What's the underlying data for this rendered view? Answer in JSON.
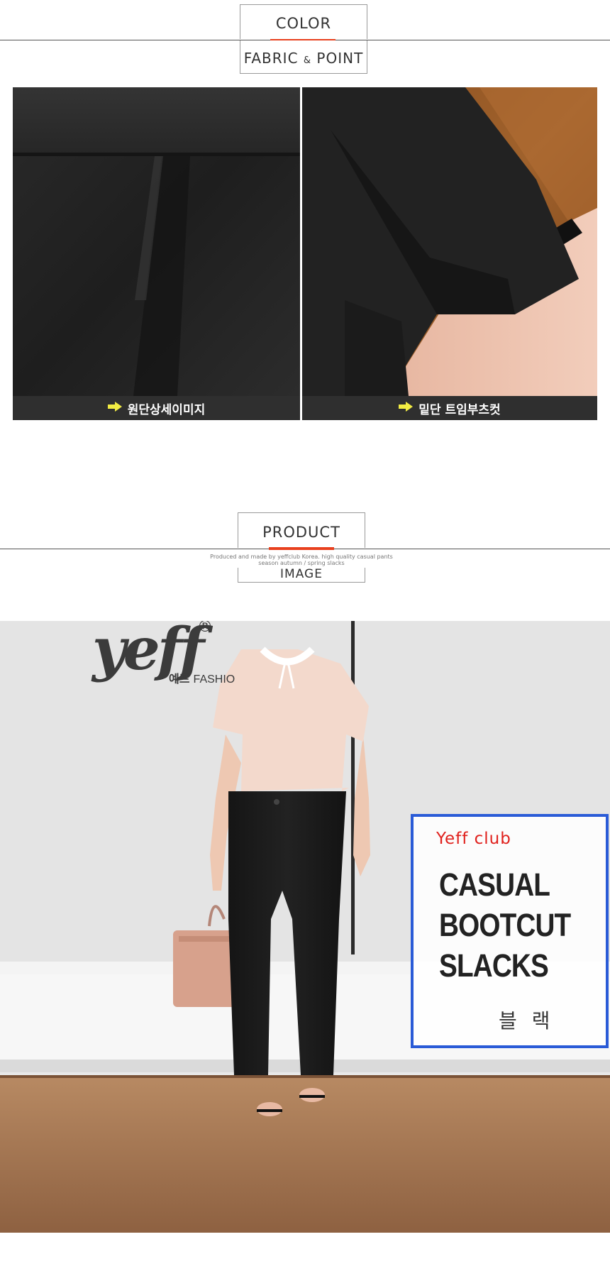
{
  "color_section": {
    "top_label": "COLOR",
    "bottom_label_main1": "FABRIC",
    "bottom_label_amp": "&",
    "bottom_label_main2": "POINT"
  },
  "fabric": {
    "left_caption": "원단상세이미지",
    "right_caption": "밑단 트임부츠컷",
    "arrow_color": "#f2ec43"
  },
  "product_section": {
    "top_label": "PRODUCT",
    "subtitle_line1": "Produced and made by yeffclub Korea. high quality casual pants",
    "subtitle_line2": "season autumn / spring slacks",
    "bottom_label": "IMAGE"
  },
  "product_image": {
    "logo_text": "yeff",
    "logo_registered": "®",
    "logo_sub_korean": "예프",
    "logo_sub_english": "FASHIO"
  },
  "info_card": {
    "brand": "Yeff club",
    "title_lines": [
      "CASUAL",
      "BOOTCUT",
      "SLACKS"
    ],
    "color_name": "블 랙",
    "brand_color": "#e0211d",
    "border_color": "#2a5bd7"
  },
  "colors": {
    "accent_red": "#e8401e",
    "caption_bar": "#2f2f2f"
  }
}
